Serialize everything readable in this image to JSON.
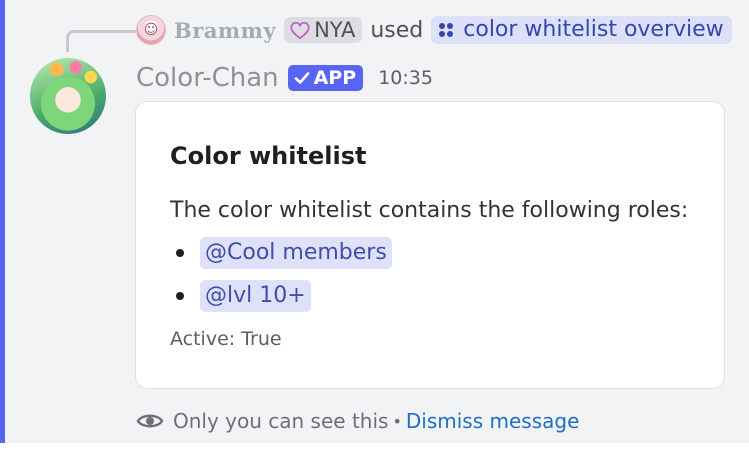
{
  "interaction": {
    "username": "Brammy",
    "tag": "NYA",
    "used_text": "used",
    "command": "color whitelist overview"
  },
  "author": {
    "name": "Color-Chan",
    "badge": "APP",
    "timestamp": "10:35"
  },
  "embed": {
    "title": "Color whitelist",
    "description": "The color whitelist contains the following roles:",
    "roles": [
      "@Cool members",
      "@lvl 10+"
    ],
    "status": "Active: True"
  },
  "ephemeral": {
    "notice": "Only you can see this",
    "separator": "•",
    "dismiss_label": "Dismiss message"
  },
  "colors": {
    "accent": "#5865f2",
    "message_bg": "#f2f3f5",
    "mention_bg": "#dfe1fb",
    "link": "#1f6fc4"
  },
  "icons": {
    "reply_avatar": "anime-avatar-icon",
    "tag": "heart-icon",
    "command": "slash-command-icon",
    "badge": "checkmark-icon",
    "ephemeral": "eye-icon"
  }
}
